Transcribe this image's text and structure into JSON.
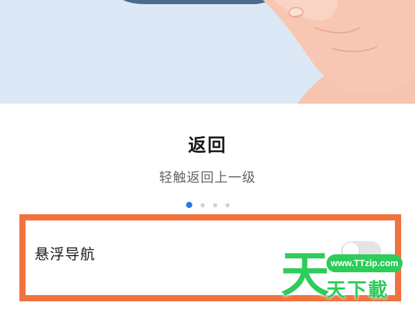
{
  "tutorial": {
    "title": "返回",
    "subtitle": "轻触返回上一级",
    "pager": {
      "total": 4,
      "active": 1
    }
  },
  "setting": {
    "label": "悬浮导航",
    "enabled": false
  },
  "watermark": {
    "logo_char": "天",
    "url": "www.TTzip.com",
    "text": "天下載"
  },
  "colors": {
    "hero_background": "#dce8f5",
    "accent": "#2a7ae2",
    "highlight_border": "#f0733f",
    "watermark_green": "#2ecc5b"
  }
}
